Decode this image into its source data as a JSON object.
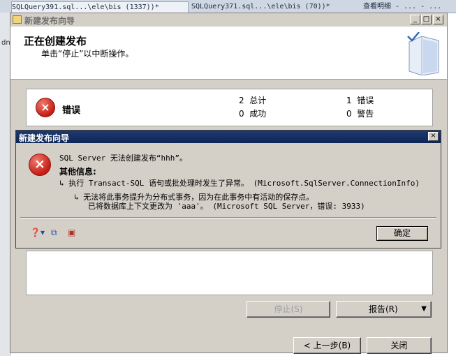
{
  "background_editor": {
    "tabs": [
      {
        "label": "SQLQuery391.sql...\\ele\\bis (1337))*"
      },
      {
        "label": "SQLQuery371.sql...\\ele\\bis (70))*"
      },
      {
        "label": "查看明细 - ... - ..."
      }
    ],
    "left_marker": "dn"
  },
  "wizard": {
    "window_title": "新建发布向导",
    "controls": {
      "minimize": "_",
      "maximize": "□",
      "close": "×"
    },
    "header_title": "正在创建发布",
    "header_subtitle": "单击“停止”以中断操作。",
    "status_panel": {
      "label": "错误",
      "stats": [
        {
          "value": "2",
          "label": "总计"
        },
        {
          "value": "1",
          "label": "错误"
        },
        {
          "value": "0",
          "label": "成功"
        },
        {
          "value": "0",
          "label": "警告"
        }
      ]
    },
    "buttons": {
      "stop": "停止(S)",
      "report": "报告(R)",
      "back": "< 上一步(B)",
      "close": "关闭"
    }
  },
  "error_dialog": {
    "title": "新建发布向导",
    "close": "×",
    "message": "SQL Server 无法创建发布“hhh”。",
    "additional_info_label": "其他信息:",
    "detail_1": "执行 Transact-SQL 语句或批处理时发生了异常。 (Microsoft.SqlServer.ConnectionInfo)",
    "detail_2_line1": "无法将此事务提升为分布式事务，因为在此事务中有活动的保存点。",
    "detail_2_line2": "已将数据库上下文更改为 'aaa'。 (Microsoft SQL Server，错误: 3933)",
    "ok_button": "确定",
    "toolbar_icons": [
      "help-icon",
      "copy-icon",
      "details-icon"
    ]
  },
  "colors": {
    "dialog_titlebar": "#0e2657",
    "window_face": "#d4d0c8",
    "error_red": "#c51d14"
  }
}
